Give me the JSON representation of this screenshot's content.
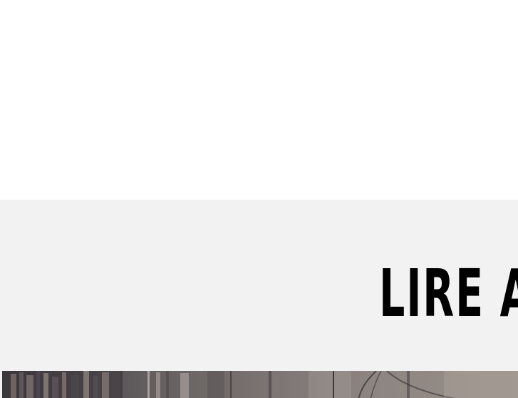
{
  "section": {
    "title": "LIRE A"
  },
  "colors": {
    "page_background": "#ffffff",
    "section_background": "#f2f2f2",
    "title_color": "#000000"
  },
  "hero_image": {
    "description_name": "library-photo"
  }
}
